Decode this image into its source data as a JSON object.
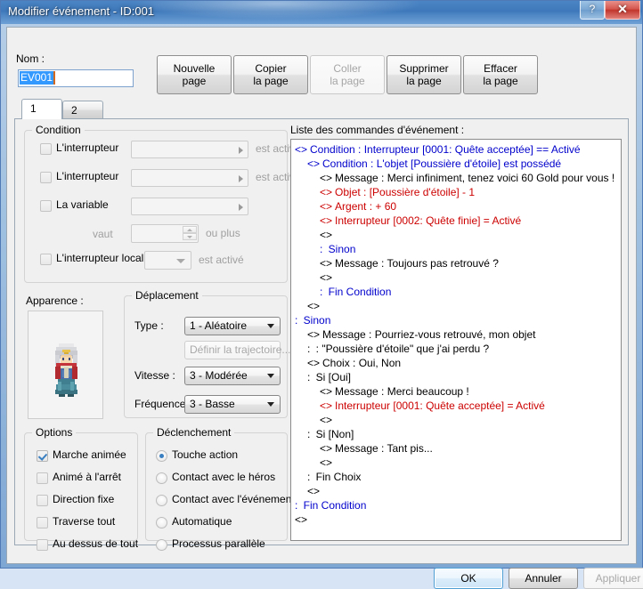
{
  "window": {
    "title": "Modifier événement - ID:001",
    "help_button": "?",
    "close_button": "✕"
  },
  "header": {
    "name_label": "Nom :",
    "name_value": "EV001",
    "name_placeholder": "",
    "buttons": [
      {
        "line1": "Nouvelle",
        "line2": "page",
        "disabled": false
      },
      {
        "line1": "Copier",
        "line2": "la page",
        "disabled": false
      },
      {
        "line1": "Coller",
        "line2": "la page",
        "disabled": true
      },
      {
        "line1": "Supprimer",
        "line2": "la page",
        "disabled": false
      },
      {
        "line1": "Effacer",
        "line2": "la page",
        "disabled": false
      }
    ]
  },
  "tabs": [
    {
      "label": "1",
      "active": true
    },
    {
      "label": "2",
      "active": false
    }
  ],
  "condition": {
    "legend": "Condition",
    "rows": [
      {
        "label": "L'interrupteur",
        "checked": false,
        "value": "",
        "suffix": "est activé"
      },
      {
        "label": "L'interrupteur",
        "checked": false,
        "value": "",
        "suffix": "est activé"
      },
      {
        "label": "La variable",
        "checked": false,
        "value": "",
        "suffix": ""
      },
      {
        "label": "L'interrupteur local",
        "checked": false,
        "value": "",
        "suffix": "est activé"
      }
    ],
    "vaut_label": "vaut",
    "vaut_value": "",
    "ou_plus_label": "ou plus"
  },
  "apparence": {
    "label": "Apparence :",
    "sprite": "character-sprite"
  },
  "deplacement": {
    "legend": "Déplacement",
    "type_label": "Type :",
    "type_value": "1 - Aléatoire",
    "trajectoire_button": "Définir la trajectoire...",
    "vitesse_label": "Vitesse :",
    "vitesse_value": "3 - Modérée",
    "frequence_label": "Fréquence :",
    "frequence_value": "3 - Basse"
  },
  "options": {
    "legend": "Options",
    "items": [
      {
        "label": "Marche animée",
        "checked": true
      },
      {
        "label": "Animé à l'arrêt",
        "checked": false
      },
      {
        "label": "Direction fixe",
        "checked": false
      },
      {
        "label": "Traverse tout",
        "checked": false
      },
      {
        "label": "Au dessus de tout",
        "checked": false
      }
    ]
  },
  "declenchement": {
    "legend": "Déclenchement",
    "items": [
      {
        "label": "Touche action",
        "selected": true
      },
      {
        "label": "Contact avec le héros",
        "selected": false
      },
      {
        "label": "Contact avec l'événement",
        "selected": false
      },
      {
        "label": "Automatique",
        "selected": false
      },
      {
        "label": "Processus parallèle",
        "selected": false
      }
    ]
  },
  "command_list": {
    "label": "Liste des commandes d'événement :",
    "lines": [
      {
        "indent": 0,
        "marker": "<>",
        "text": "Condition : Interrupteur [0001: Quête acceptée] == Activé",
        "color": "blue"
      },
      {
        "indent": 1,
        "marker": "<>",
        "text": "Condition : L'objet [Poussière d'étoile] est possédé",
        "color": "blue"
      },
      {
        "indent": 2,
        "marker": "<>",
        "text": "Message : Merci infiniment, tenez voici 60 Gold pour vous !",
        "color": "black"
      },
      {
        "indent": 2,
        "marker": "<>",
        "text": "Objet : [Poussière d'étoile] - 1",
        "color": "red"
      },
      {
        "indent": 2,
        "marker": "<>",
        "text": "Argent : + 60",
        "color": "red"
      },
      {
        "indent": 2,
        "marker": "<>",
        "text": "Interrupteur [0002: Quête finie] = Activé",
        "color": "red"
      },
      {
        "indent": 2,
        "marker": "<>",
        "text": "",
        "color": "black"
      },
      {
        "indent": 2,
        "marker": ":",
        "text": "Sinon",
        "color": "blue"
      },
      {
        "indent": 2,
        "marker": "<>",
        "text": "Message : Toujours pas retrouvé ?",
        "color": "black"
      },
      {
        "indent": 2,
        "marker": "<>",
        "text": "",
        "color": "black"
      },
      {
        "indent": 2,
        "marker": ":",
        "text": "Fin Condition",
        "color": "blue"
      },
      {
        "indent": 1,
        "marker": "<>",
        "text": "",
        "color": "black"
      },
      {
        "indent": 0,
        "marker": ":",
        "text": "Sinon",
        "color": "blue"
      },
      {
        "indent": 1,
        "marker": "<>",
        "text": "Message : Pourriez-vous retrouvé, mon objet",
        "color": "black"
      },
      {
        "indent": 1,
        "marker": ":",
        "text": "           : \"Poussière d'étoile\" que j'ai perdu ?",
        "color": "black"
      },
      {
        "indent": 1,
        "marker": "<>",
        "text": "Choix : Oui, Non",
        "color": "black"
      },
      {
        "indent": 1,
        "marker": ":",
        "text": "Si [Oui]",
        "color": "black"
      },
      {
        "indent": 2,
        "marker": "<>",
        "text": "Message : Merci beaucoup !",
        "color": "black"
      },
      {
        "indent": 2,
        "marker": "<>",
        "text": "Interrupteur [0001: Quête acceptée] = Activé",
        "color": "red"
      },
      {
        "indent": 2,
        "marker": "<>",
        "text": "",
        "color": "black"
      },
      {
        "indent": 1,
        "marker": ":",
        "text": "Si [Non]",
        "color": "black"
      },
      {
        "indent": 2,
        "marker": "<>",
        "text": "Message : Tant pis...",
        "color": "black"
      },
      {
        "indent": 2,
        "marker": "<>",
        "text": "",
        "color": "black"
      },
      {
        "indent": 1,
        "marker": ":",
        "text": "Fin Choix",
        "color": "black"
      },
      {
        "indent": 1,
        "marker": "<>",
        "text": "",
        "color": "black"
      },
      {
        "indent": 0,
        "marker": ":",
        "text": "Fin Condition",
        "color": "blue"
      },
      {
        "indent": 0,
        "marker": "<>",
        "text": "",
        "color": "black"
      }
    ]
  },
  "footer": {
    "ok": "OK",
    "cancel": "Annuler",
    "apply": "Appliquer"
  },
  "colors": {
    "titlebar_blue": "#3f79bb",
    "close_red": "#c2352c",
    "command_blue": "#0000cc",
    "command_red": "#cc0000",
    "selection_blue": "#3399ff",
    "accent_check": "#3a7fc1"
  }
}
